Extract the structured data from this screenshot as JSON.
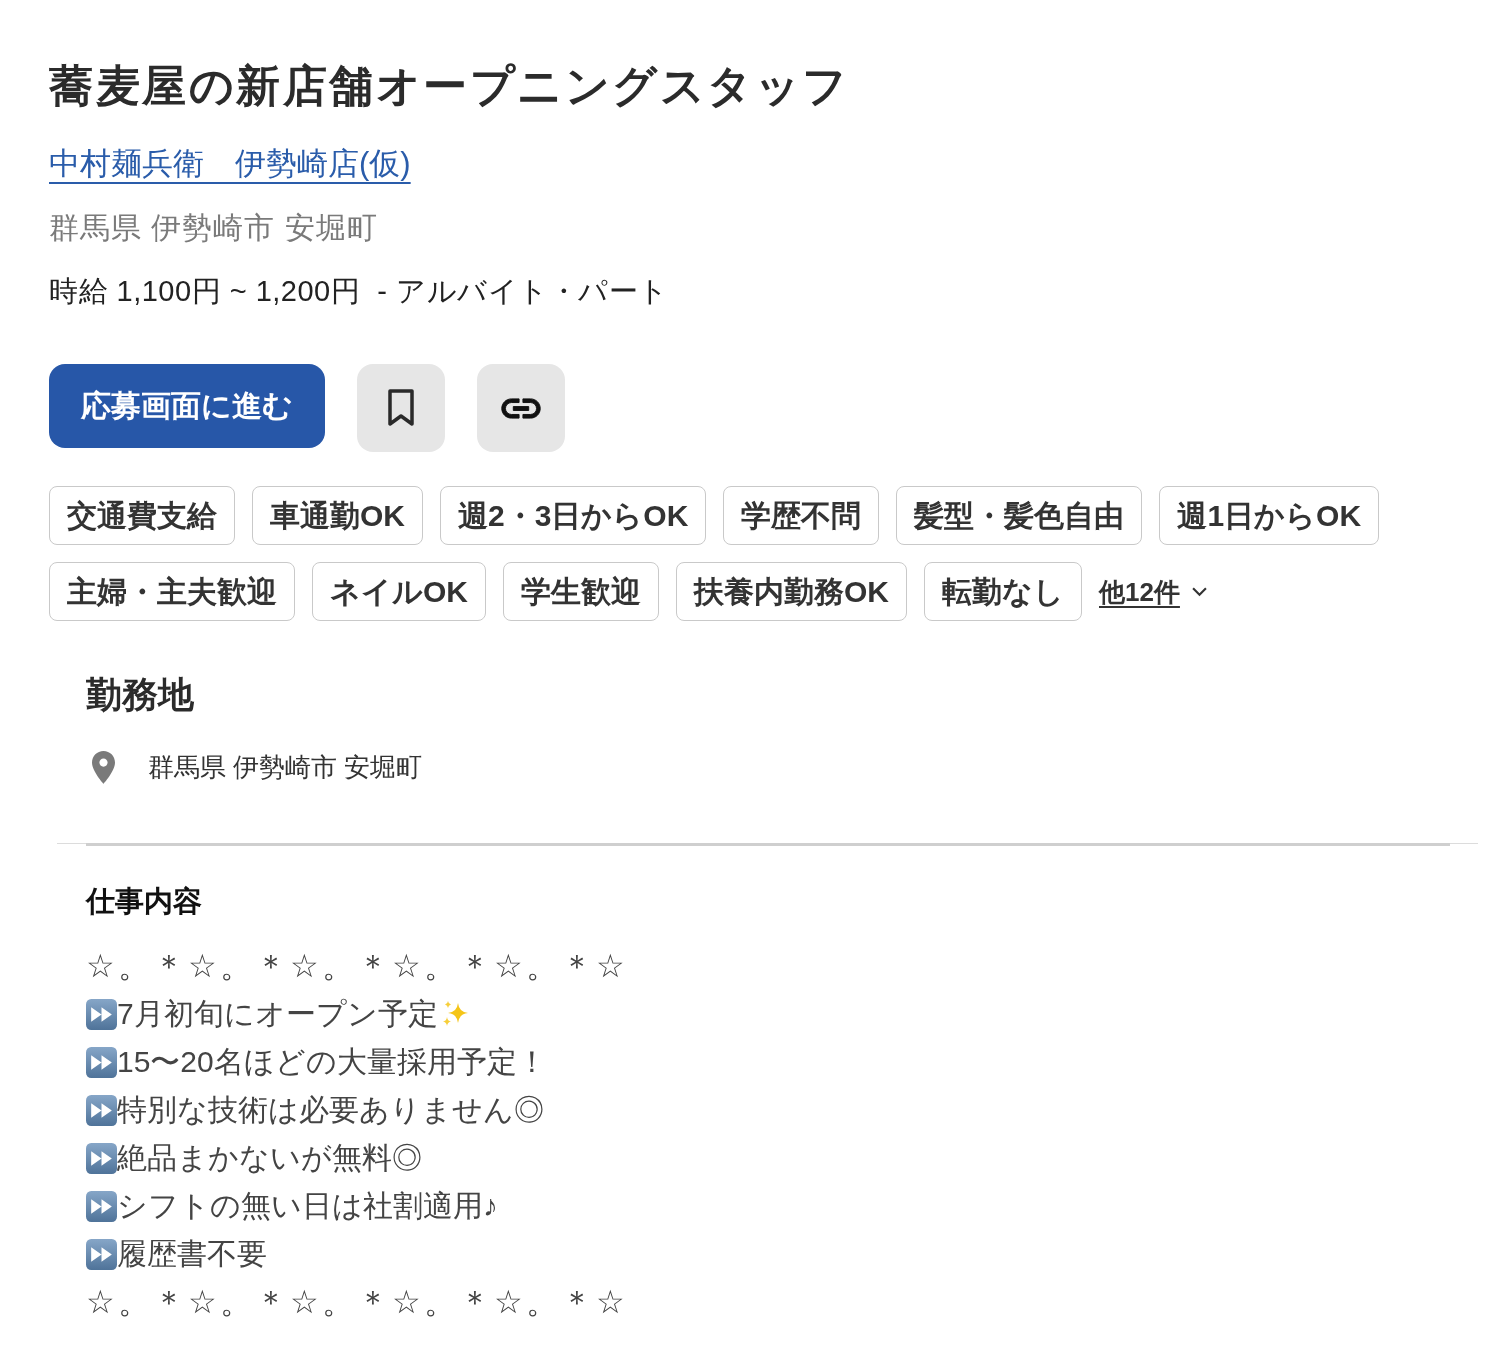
{
  "job": {
    "title": "蕎麦屋の新店舗オープニングスタッフ",
    "company": "中村麺兵衛　伊勢崎店(仮)",
    "address": "群馬県 伊勢崎市 安堀町",
    "salary": "時給 1,100円 ~ 1,200円  - アルバイト・パート"
  },
  "actions": [
    {
      "kind": "apply",
      "label": "応募画面に進む"
    },
    {
      "kind": "bookmark"
    },
    {
      "kind": "copy_link"
    }
  ],
  "tags": [
    "交通費支給",
    "車通勤OK",
    "週2・3日からOK",
    "学歴不問",
    "髪型・髪色自由",
    "週1日からOK",
    "主婦・主夫歓迎",
    "ネイルOK",
    "学生歓迎",
    "扶養内勤務OK",
    "転勤なし"
  ],
  "more_tags": {
    "label": "他12件",
    "expanded": false
  },
  "work_location": {
    "heading": "勤務地",
    "address": "群馬県 伊勢崎市 安堀町"
  },
  "job_description": {
    "heading": "仕事内容",
    "lines": [
      {
        "kind": "decoration",
        "text": "☆。＊☆。＊☆。＊☆。＊☆。＊☆"
      },
      {
        "kind": "bullet",
        "text": "7月初旬にオープン予定",
        "sparkle": true
      },
      {
        "kind": "bullet",
        "text": "15〜20名ほどの大量採用予定！",
        "sparkle": false
      },
      {
        "kind": "bullet",
        "text": "特別な技術は必要ありません◎",
        "sparkle": false
      },
      {
        "kind": "bullet",
        "text": "絶品まかないが無料◎",
        "sparkle": false
      },
      {
        "kind": "bullet",
        "text": "シフトの無い日は社割適用♪",
        "sparkle": false
      },
      {
        "kind": "bullet",
        "text": "履歴書不要",
        "sparkle": false
      },
      {
        "kind": "decoration",
        "text": "☆。＊☆。＊☆。＊☆。＊☆。＊☆"
      }
    ]
  }
}
